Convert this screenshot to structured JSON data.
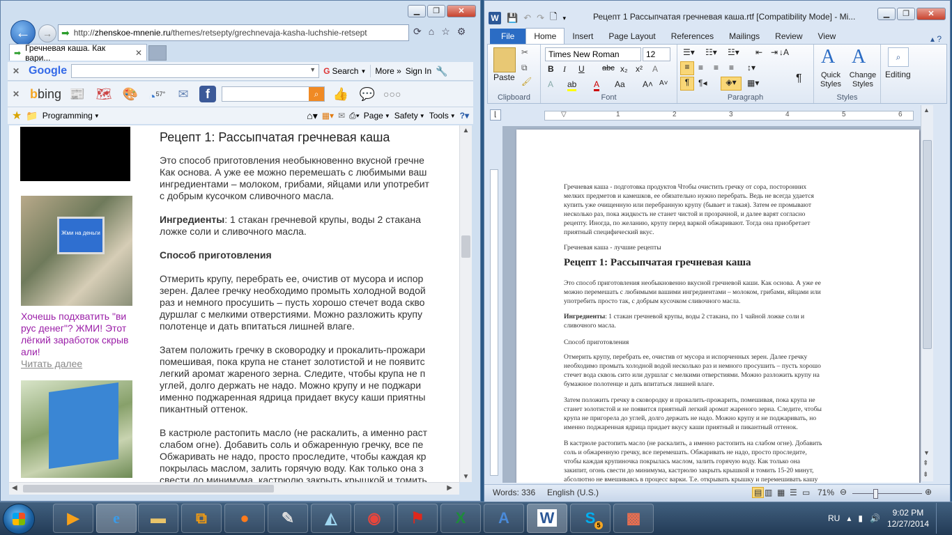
{
  "ie": {
    "url_prefix": "http://",
    "url_host": "zhenskoe-mnenie.ru",
    "url_path": "/themes/retsepty/grechnevaja-kasha-luchshie-retsept",
    "tab_title": "Гречневая каша. Как вари...",
    "google_toolbar": {
      "logo": "Google",
      "search_label": "Search",
      "more_label": "More »",
      "signin_label": "Sign In"
    },
    "bing_toolbar": {
      "logo": "bing",
      "weather_temp": "57°"
    },
    "favorites": {
      "folder_label": "Programming"
    },
    "command_bar": {
      "page_label": "Page",
      "safety_label": "Safety",
      "tools_label": "Tools"
    },
    "sidebar": {
      "ad_text": "Хочешь подхватить \"ви рус денег\"? ЖМИ! Этот лёгкий заработок скрыв али!",
      "read_more": "Читать далее",
      "ad_banner_text": "Жми на деньги"
    },
    "article": {
      "title": "Рецепт 1: Рассыпчатая гречневая каша",
      "intro_lines": [
        " Это способ приготовления необыкновенно вкусной гречне",
        "Как основа. А уже ее можно перемешать с любимыми ваш",
        "ингредиентами – молоком, грибами, яйцами или употребит",
        "с добрым кусочком сливочного масла."
      ],
      "ingredients_label": "Ингредиенты",
      "ingredients_lines": [
        ": 1 стакан гречневой крупы, воды 2 стакана",
        "ложке соли и сливочного масла."
      ],
      "method_title": "Способ приготовления",
      "p1": [
        "Отмерить крупу, перебрать ее, очистив от мусора и испор",
        "зерен. Далее гречку необходимо промыть холодной водой",
        "раз и немного просушить – пусть хорошо стечет вода скво",
        "дуршлаг с мелкими отверстиями. Можно разложить крупу",
        "полотенце и дать впитаться лишней влаге."
      ],
      "p2": [
        "Затем положить гречку в сковородку и прокалить-прожари",
        "помешивая, пока крупа не станет золотистой и не появитс",
        "легкий аромат жареного зерна. Следите, чтобы крупа не п",
        "углей, долго держать не надо. Можно крупу и не поджари",
        "именно поджаренная ядрица придает вкусу каши приятны",
        "пикантный оттенок."
      ],
      "p3": [
        "В кастрюле растопить масло (не раскалить, а именно раст",
        "слабом огне). Добавить соль и обжаренную гречку, все пе",
        "Обжаривать не надо, просто проследите, чтобы каждая кр",
        "покрылась маслом, залить горячую воду. Как только она з",
        "свести до минимума, кастрюлю закрыть крышкой и томить"
      ]
    }
  },
  "word": {
    "title": "Рецепт 1 Рассыпчатая гречневая каша.rtf [Compatibility Mode] - Mi...",
    "tabs": [
      "File",
      "Home",
      "Insert",
      "Page Layout",
      "References",
      "Mailings",
      "Review",
      "View"
    ],
    "ribbon": {
      "paste_label": "Paste",
      "font_name": "Times New Roman",
      "font_size": "12",
      "clipboard_label": "Clipboard",
      "font_label": "Font",
      "paragraph_label": "Paragraph",
      "styles_label": "Styles",
      "quick_styles_label": "Quick Styles",
      "change_styles_label": "Change Styles",
      "editing_label": "Editing"
    },
    "ruler_numbers": [
      "1",
      "2",
      "3",
      "4",
      "5",
      "6"
    ],
    "doc": {
      "intro": [
        "Гречневая каша - подготовка продуктов Чтобы очистить гречку от сора, посторонних",
        "мелких предметов и камешков, ее обязательно нужно перебрать. Ведь не всегда удается",
        "купить уже очищенную или перебранную крупу (бывает и такая). Затем ее промывают",
        "несколько раз, пока жидкость не станет чистой и прозрачной, и далее варят согласно",
        "рецепту. Иногда, по желанию, крупу перед варкой обжаривают. Тогда она приобретает",
        "приятный специфический вкус."
      ],
      "subtitle": "Гречневая каша - лучшие рецепты",
      "heading": "Рецепт 1: Рассыпчатая гречневая каша",
      "p_intro": [
        "Это способ приготовления необыкновенно вкусной гречневой каши. Как основа. А уже ее",
        "можно перемешать с любимыми вашими ингредиентами – молоком, грибами, яйцами или",
        "употребить просто так, с добрым кусочком сливочного масла."
      ],
      "ingredients_label": "Ингредиенты",
      "ingredients": [
        ": 1 стакан гречневой крупы, воды 2 стакана, по 1 чайной ложке соли и",
        "сливочного масла."
      ],
      "method_title": "Способ приготовления",
      "p1": [
        "Отмерить крупу, перебрать ее, очистив от мусора и испорченных зерен. Далее гречку",
        "необходимо промыть холодной водой несколько раз и немного просушить – пусть хорошо",
        "стечет вода сквозь сито или дуршлаг с мелкими отверстиями. Можно разложить крупу на",
        "бумажное полотенце и дать впитаться лишней влаге."
      ],
      "p2": [
        "Затем положить гречку в сковородку и прокалить-прожарить, помешивая, пока крупа не",
        "станет золотистой и не появится приятный легкий аромат жареного зерна. Следите, чтобы",
        "крупа не пригорела до углей, долго держать не надо. Можно крупу и не поджаривать, но",
        "именно поджаренная ядрица придает вкусу каши приятный и пикантный оттенок."
      ],
      "p3": [
        "В кастрюле растопить масло (не раскалить, а именно растопить на слабом огне). Добавить",
        "соль и обжаренную гречку, все перемешать. Обжаривать не надо, просто проследите,",
        "чтобы каждая крупиночка покрылась маслом, залить горячую воду. Как только она",
        "закипит, огонь свести до минимума, кастрюлю закрыть крышкой и томить 15-20 минут,",
        "абсолютно не вмешиваясь в процесс варки. Т.е. открывать крышку и перемешивать кашу"
      ]
    },
    "status": {
      "words": "Words: 336",
      "language": "English (U.S.)",
      "zoom": "71%"
    }
  },
  "taskbar": {
    "apps": [
      "windows-media",
      "internet-explorer",
      "file-explorer",
      "office-shapes",
      "firefox",
      "notepad",
      "glass-tool",
      "chrome",
      "acrobat",
      "excel",
      "wordpad",
      "word",
      "skype",
      "paint"
    ],
    "skype_badge": "5",
    "language": "RU",
    "time": "9:02 PM",
    "date": "12/27/2014"
  }
}
